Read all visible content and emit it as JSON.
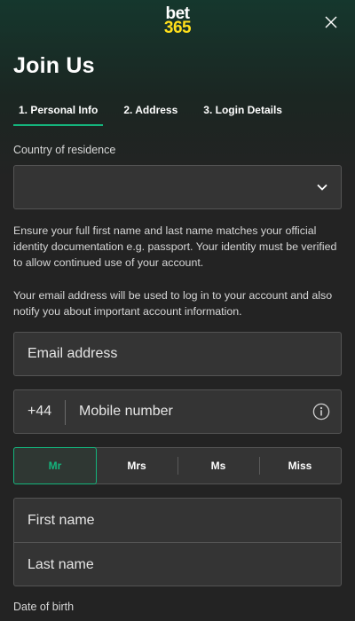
{
  "brand": {
    "logo_top": "bet",
    "logo_bottom": "365",
    "logo_bottom_color": "#ffdf1b",
    "accent_color": "#14b47c"
  },
  "header": {
    "close_icon": "close-icon"
  },
  "page": {
    "title": "Join Us"
  },
  "tabs": [
    {
      "label": "1. Personal Info",
      "active": true
    },
    {
      "label": "2. Address",
      "active": false
    },
    {
      "label": "3. Login Details",
      "active": false
    }
  ],
  "country": {
    "label": "Country of residence",
    "value": "",
    "icon": "chevron-down-icon"
  },
  "info": {
    "identity_text": "Ensure your full first name and last name matches your official identity documentation e.g. passport. Your identity must be verified to allow continued use of your account.",
    "email_text": "Your email address will be used to log in to your account and also notify you about important account information."
  },
  "email": {
    "placeholder": "Email address"
  },
  "mobile": {
    "prefix": "+44",
    "placeholder": "Mobile number",
    "icon": "info-icon"
  },
  "titles": {
    "options": [
      "Mr",
      "Mrs",
      "Ms",
      "Miss"
    ],
    "selected": "Mr"
  },
  "name": {
    "first_placeholder": "First name",
    "last_placeholder": "Last name"
  },
  "dob": {
    "label": "Date of birth"
  }
}
